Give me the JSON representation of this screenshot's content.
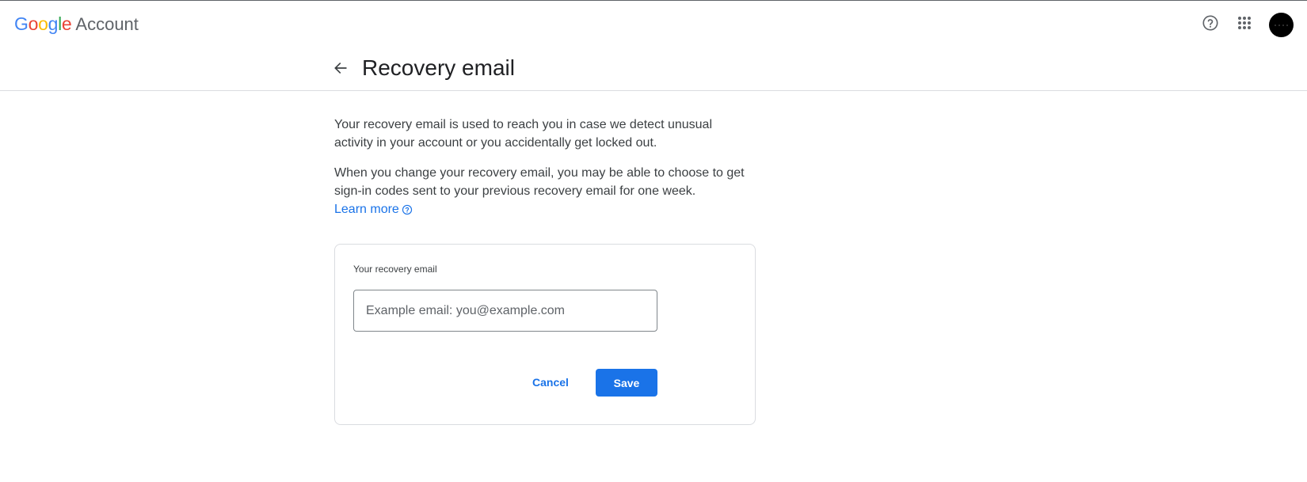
{
  "header": {
    "logo_letters": [
      {
        "char": "G",
        "color": "#4285F4"
      },
      {
        "char": "o",
        "color": "#EA4335"
      },
      {
        "char": "o",
        "color": "#FBBC05"
      },
      {
        "char": "g",
        "color": "#4285F4"
      },
      {
        "char": "l",
        "color": "#34A853"
      },
      {
        "char": "e",
        "color": "#EA4335"
      }
    ],
    "product_name": "Account",
    "icons": {
      "help": "help-circle-icon",
      "apps": "apps-grid-icon",
      "avatar": "account-avatar"
    }
  },
  "page": {
    "title": "Recovery email",
    "back_icon": "arrow-back-icon"
  },
  "content": {
    "paragraph_1": "Your recovery email is used to reach you in case we detect unusual activity in your account or you accidentally get locked out.",
    "paragraph_2": "When you change your recovery email, you may be able to choose to get sign-in codes sent to your previous recovery email for one week.",
    "learn_more": "Learn more",
    "learn_more_icon": "help-circle-icon"
  },
  "form": {
    "label": "Your recovery email",
    "input_value": "",
    "input_placeholder": "Example email: you@example.com",
    "cancel_label": "Cancel",
    "save_label": "Save"
  },
  "colors": {
    "accent": "#1a73e8",
    "text_primary": "#202124",
    "text_secondary": "#3c4043",
    "border": "#dadce0"
  }
}
